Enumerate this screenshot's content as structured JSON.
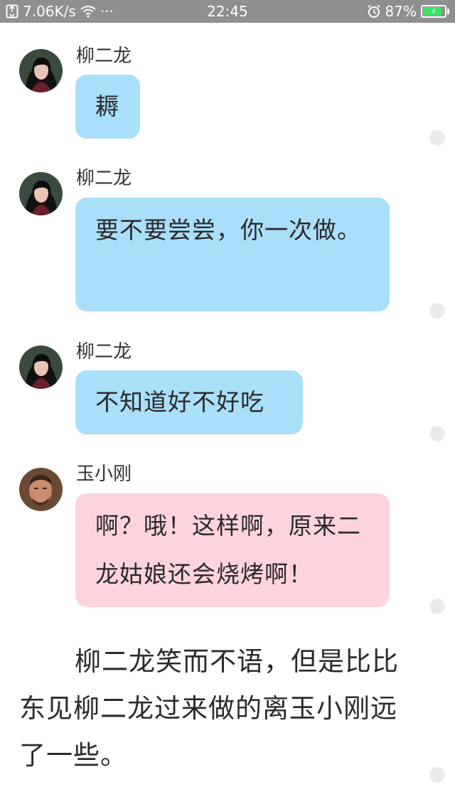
{
  "status_bar": {
    "network_speed": "7.06K/s",
    "more": "···",
    "time": "22:45",
    "battery_percent": "87%",
    "battery_level": 0.87,
    "battery_color": "#3fe06a",
    "bar_color": "#8f8f8f"
  },
  "messages": [
    {
      "sender": "柳二龙",
      "text": "耨",
      "bubble_color": "#a9dff9",
      "avatar": "female-avatar"
    },
    {
      "sender": "柳二龙",
      "text": "要不要尝尝，你一次做。",
      "bubble_color": "#a9dff9",
      "avatar": "female-avatar"
    },
    {
      "sender": "柳二龙",
      "text": "不知道好不好吃",
      "bubble_color": "#a9dff9",
      "avatar": "female-avatar"
    },
    {
      "sender": "玉小刚",
      "text": "啊？哦！这样啊，原来二龙姑娘还会烧烤啊！",
      "bubble_color": "#fdd4dd",
      "avatar": "male-avatar"
    }
  ],
  "narration": "柳二龙笑而不语，但是比比东见柳二龙过来做的离玉小刚远了一些。"
}
